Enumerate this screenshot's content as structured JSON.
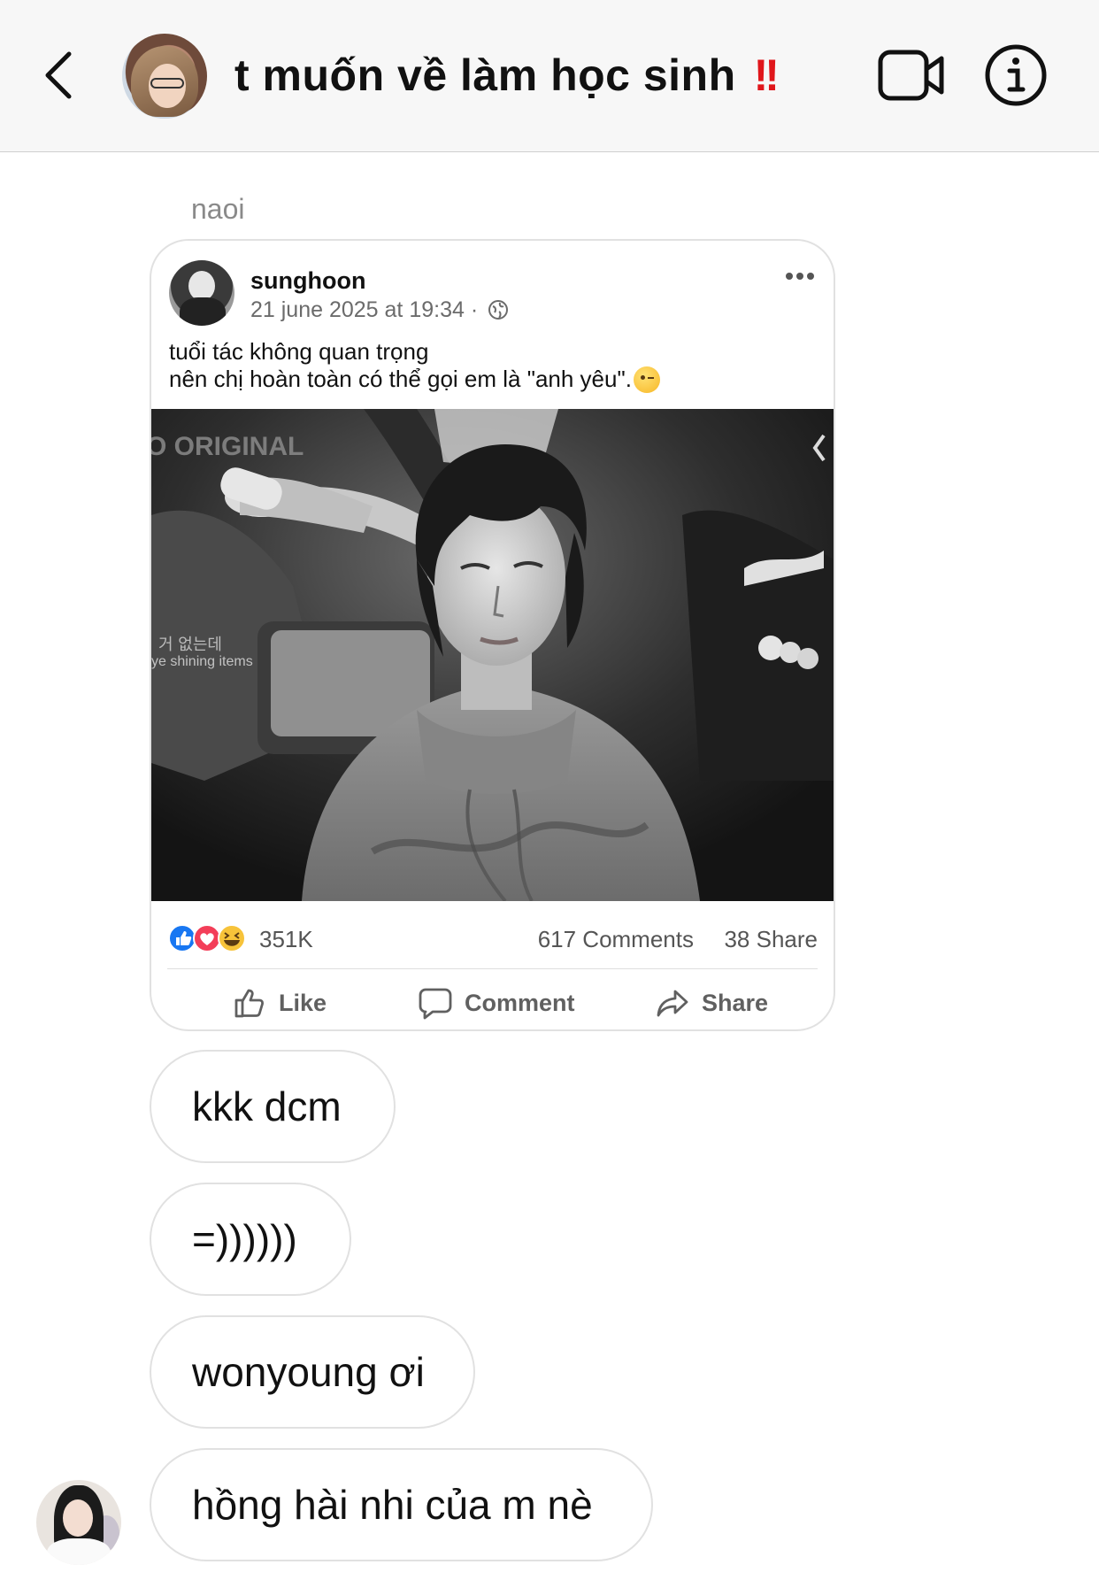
{
  "header": {
    "title": "t muốn về làm học sinh",
    "title_emoji": "‼️",
    "back_icon": "chevron-left-icon",
    "video_icon": "video-camera-icon",
    "info_icon": "info-icon"
  },
  "thread": {
    "sender_name": "naoi",
    "shared_post": {
      "username": "sunghoon",
      "date": "21 june 2025 at 19:34 ·",
      "caption_line1": "tuổi tác không quan trọng",
      "caption_line2": "nên chị hoàn toàn có thể gọi em là \"anh yêu\".",
      "reaction_count": "351K",
      "comments": "617 Comments",
      "shares": "38 Share",
      "actions": {
        "like": "Like",
        "comment": "Comment",
        "share": "Share"
      },
      "photo_overlay": {
        "top_left": "O ORIGINAL",
        "left_korean": "거 없는데",
        "left_english": "ye   shining items"
      }
    },
    "messages": [
      {
        "text": "kkk dcm"
      },
      {
        "text": "=))))))"
      },
      {
        "text": "wonyoung ơi"
      },
      {
        "text": "hồng hài nhi của m nè"
      }
    ]
  },
  "colors": {
    "header_bg": "#f7f7f7",
    "bubble_border": "#e1e1e1",
    "alert_red": "#e0161b",
    "like_blue": "#1877f2",
    "love_red": "#f33e58"
  }
}
